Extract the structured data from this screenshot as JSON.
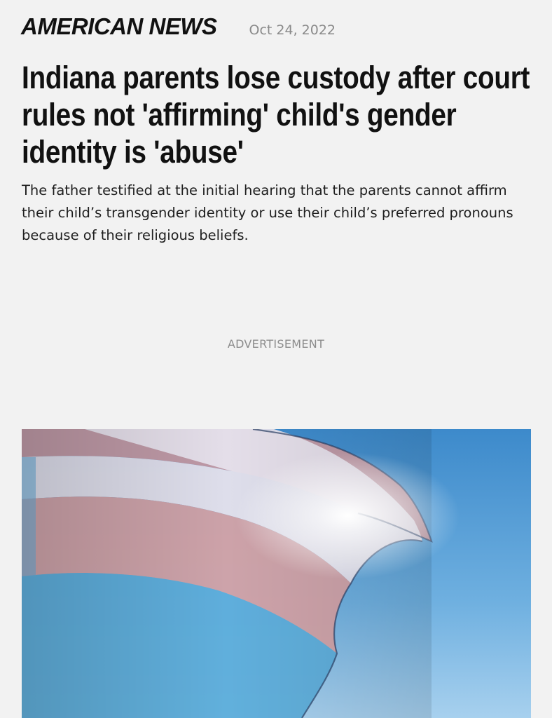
{
  "header": {
    "brand": "AMERICAN NEWS",
    "date": "Oct 24, 2022"
  },
  "article": {
    "headline": "Indiana parents lose custody after court rules not 'affirming' child's gender identity is 'abuse'",
    "subheadline": "The father testified at the initial hearing that the parents cannot affirm their child’s transgender identity or use their child’s preferred pronouns because of their religious beliefs.",
    "advertisement_label": "ADVERTISEMENT"
  },
  "colors": {
    "background": "#f2f2f2",
    "flag_blue": "#5aa9d6",
    "flag_pink": "#d49a9a",
    "flag_white": "#e8e4ee",
    "sky": "#3f8fd0"
  },
  "hero_image": {
    "icon": "transgender-flag-photo"
  }
}
